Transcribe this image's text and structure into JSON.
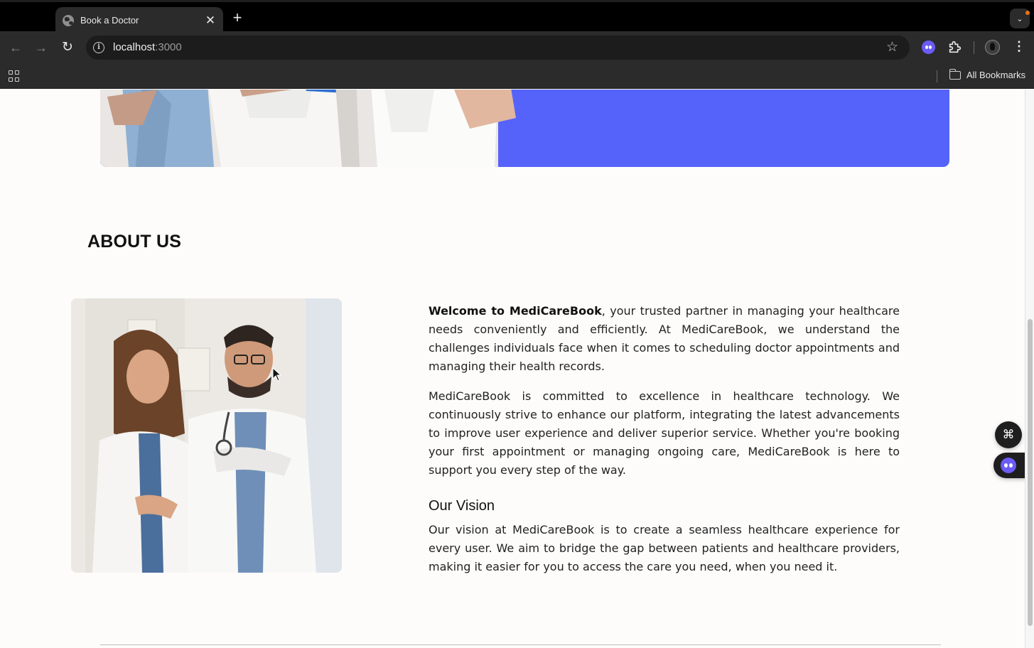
{
  "browser": {
    "tab_title": "Book a Doctor",
    "tab_close": "✕",
    "new_tab": "+",
    "tab_search": "⌄",
    "url_host": "localhost",
    "url_port": ":3000",
    "back": "←",
    "forward": "→",
    "reload": "↻",
    "info": "i",
    "star": "☆",
    "menu": "⋮",
    "all_bookmarks": "All Bookmarks"
  },
  "icons": {
    "tab": "globe-icon",
    "bookmark": "star-icon",
    "extensions": "puzzle-icon",
    "apps": "apps-grid-icon",
    "folder": "folder-icon",
    "float_command": "command-icon",
    "float_assistant": "ghost-bot-icon"
  },
  "colors": {
    "hero": "#5663fa",
    "assistant": "#6a5cf5",
    "page_bg": "#fdfcfb"
  },
  "about": {
    "heading": "ABOUT US",
    "intro_bold": "Welcome to MediCareBook",
    "intro_rest": ", your trusted partner in managing your healthcare needs conveniently and efficiently. At MediCareBook, we understand the challenges individuals face when it comes to scheduling doctor appointments and managing their health records.",
    "commitment": "MediCareBook is committed to excellence in healthcare technology. We continuously strive to enhance our platform, integrating the latest advancements to improve user experience and deliver superior service. Whether you're booking your first appointment or managing ongoing care, MediCareBook is here to support you every step of the way.",
    "vision_title": "Our Vision",
    "vision_text": "Our vision at MediCareBook is to create a seamless healthcare experience for every user. We aim to bridge the gap between patients and healthcare providers, making it easier for you to access the care you need, when you need it."
  },
  "floating": {
    "command_glyph": "⌘"
  }
}
